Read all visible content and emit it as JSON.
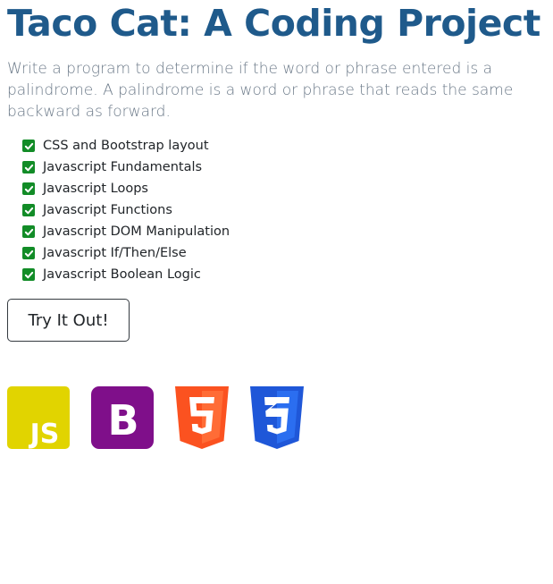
{
  "page": {
    "title": "Taco Cat: A Coding Project",
    "description": "Write a program to determine if the word or phrase entered is a palindrome. A palindrome is a word or phrase that reads the same backward as forward."
  },
  "skills": [
    {
      "label": "CSS and Bootstrap layout"
    },
    {
      "label": "Javascript Fundamentals"
    },
    {
      "label": "Javascript Loops"
    },
    {
      "label": "Javascript Functions"
    },
    {
      "label": "Javascript DOM Manipulation"
    },
    {
      "label": "Javascript If/Then/Else"
    },
    {
      "label": "Javascript Boolean Logic"
    }
  ],
  "cta": {
    "label": "Try It Out!"
  },
  "logos": {
    "js": {
      "icon": "javascript-logo",
      "text": "JS",
      "color": "#e1d400"
    },
    "bootstrap": {
      "icon": "bootstrap-logo",
      "text": "B",
      "color": "#7f0f8a"
    },
    "html5": {
      "icon": "html5-logo",
      "text": "5",
      "color": "#fb5220"
    },
    "css3": {
      "icon": "css3-logo",
      "text": "3",
      "color": "#1f57d8"
    }
  },
  "colors": {
    "heading": "#1f5a8b",
    "lead": "#6c7a89",
    "check": "#128c27"
  }
}
